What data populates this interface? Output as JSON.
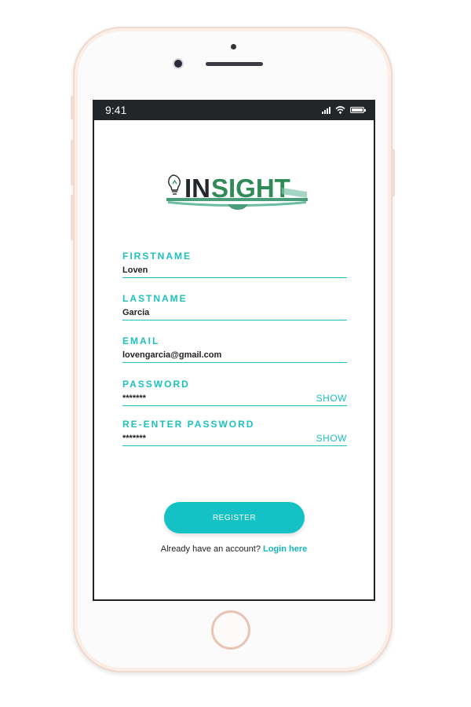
{
  "status_bar": {
    "time": "9:41"
  },
  "logo": {
    "alt": "INSIGHT logo",
    "prefix": "IN",
    "suffix": "SIGHT"
  },
  "form": {
    "firstname": {
      "label": "FIRSTNAME",
      "value": "Loven"
    },
    "lastname": {
      "label": "LASTNAME",
      "value": "Garcia"
    },
    "email": {
      "label": "EMAIL",
      "value": "lovengarcia@gmail.com"
    },
    "password": {
      "label": "PASSWORD",
      "value": "*******",
      "toggle": "SHOW"
    },
    "reenter_password": {
      "label": "RE-ENTER PASSWORD",
      "value": "*******",
      "toggle": "SHOW"
    }
  },
  "register_button": "REGISTER",
  "login_prompt": {
    "text": "Already have an account?",
    "link": "Login here"
  },
  "colors": {
    "accent": "#14c1c4",
    "logo_dark": "#23272b",
    "logo_green": "#2e8b57"
  },
  "icons": [
    "signal-icon",
    "wifi-icon",
    "battery-icon",
    "lightbulb-icon",
    "book-icon"
  ]
}
